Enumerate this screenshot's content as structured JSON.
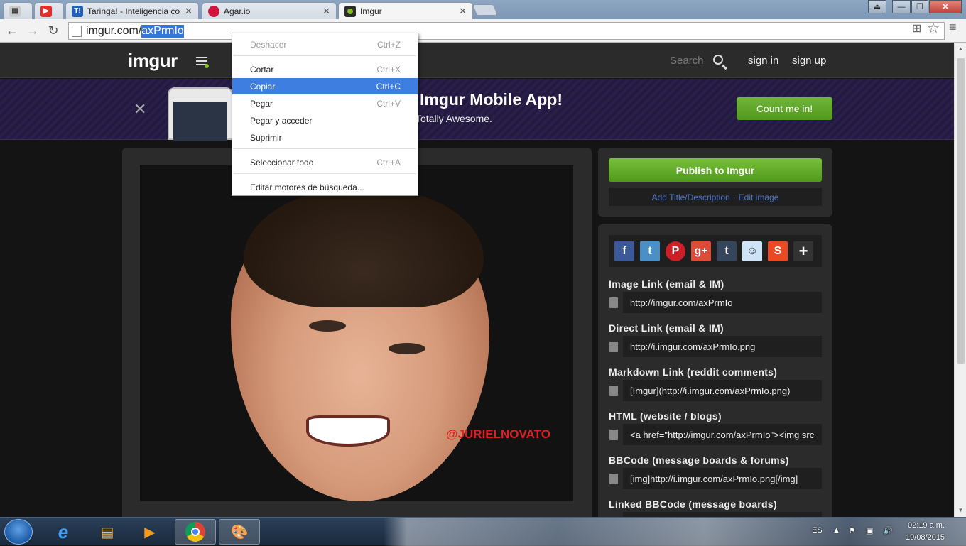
{
  "browser": {
    "tabs": [
      {
        "title": "",
        "icon": "chrome-apps-icon"
      },
      {
        "title": "",
        "icon": "youtube-icon"
      },
      {
        "title": "Taringa! - Inteligencia col",
        "icon": "taringa-icon"
      },
      {
        "title": "Agar.io",
        "icon": "agario-icon"
      },
      {
        "title": "Imgur",
        "icon": "imgur-icon",
        "active": true
      }
    ],
    "url_host": "imgur.com/",
    "url_path": "axPrmIo"
  },
  "header": {
    "logo": "imgur",
    "search_label": "Search",
    "sign_in": "sign in",
    "sign_up": "sign up"
  },
  "banner": {
    "title": "Imgur Mobile App!",
    "subtitle": "Totally Awesome.",
    "cta": "Count me in!"
  },
  "image": {
    "watermark": "@JURIELNOVATO"
  },
  "publish": {
    "button": "Publish to Imgur",
    "add_title": "Add Title/Description",
    "separator": "·",
    "edit_image": "Edit image"
  },
  "share": {
    "icons": [
      "facebook",
      "twitter",
      "pinterest",
      "google-plus",
      "tumblr",
      "reddit",
      "stumbleupon",
      "more"
    ],
    "links": [
      {
        "label": "Image Link (email & IM)",
        "value": "http://imgur.com/axPrmIo"
      },
      {
        "label": "Direct Link (email & IM)",
        "value": "http://i.imgur.com/axPrmIo.png"
      },
      {
        "label": "Markdown Link (reddit comments)",
        "value": "[Imgur](http://i.imgur.com/axPrmIo.png)"
      },
      {
        "label": "HTML (website / blogs)",
        "value": "<a href=\"http://imgur.com/axPrmIo\"><img src"
      },
      {
        "label": "BBCode (message boards & forums)",
        "value": "[img]http://i.imgur.com/axPrmIo.png[/img]"
      },
      {
        "label": "Linked BBCode (message boards)",
        "value": ""
      }
    ]
  },
  "context_menu": {
    "items": [
      {
        "label": "Deshacer",
        "shortcut": "Ctrl+Z",
        "disabled": true
      },
      {
        "label": "Cortar",
        "shortcut": "Ctrl+X"
      },
      {
        "label": "Copiar",
        "shortcut": "Ctrl+C",
        "highlighted": true
      },
      {
        "label": "Pegar",
        "shortcut": "Ctrl+V"
      },
      {
        "label": "Pegar y acceder",
        "shortcut": ""
      },
      {
        "label": "Suprimir",
        "shortcut": ""
      },
      {
        "label": "Seleccionar todo",
        "shortcut": "Ctrl+A"
      },
      {
        "label": "Editar motores de búsqueda...",
        "shortcut": ""
      }
    ]
  },
  "taskbar": {
    "language": "ES",
    "time": "02:19 a.m.",
    "date": "19/08/2015"
  },
  "colors": {
    "accent_green": "#85bf25",
    "menu_highlight": "#3d7ee0",
    "link_blue": "#4e76c9",
    "watermark_red": "#e02020"
  }
}
